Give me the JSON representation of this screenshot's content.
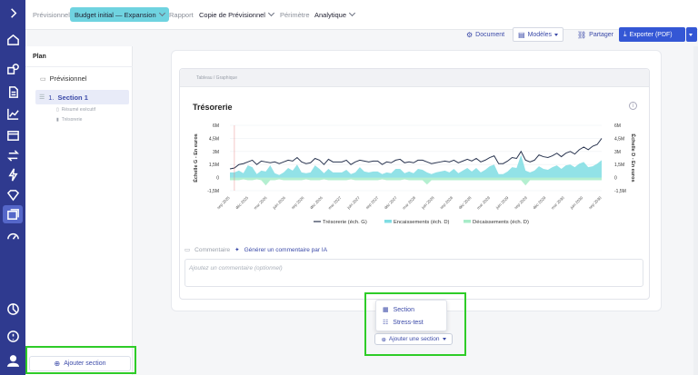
{
  "topbar": {
    "previsionnel_label": "Prévisionnel",
    "budget_value": "Budget initial — Expansion",
    "rapport_label": "Rapport",
    "rapport_value": "Copie de Prévisionnel",
    "perimetre_label": "Périmètre",
    "perimetre_value": "Analytique"
  },
  "toolbar": {
    "document": "Document",
    "modeles": "Modèles",
    "partager": "Partager",
    "exporter": "Exporter (PDF)"
  },
  "plan": {
    "title": "Plan",
    "previsionnel": "Prévisionnel",
    "section_number": "1.",
    "section_label": "Section 1",
    "sub_items": [
      "Résumé exécutif",
      "Trésorerie"
    ],
    "add_section": "Ajouter section"
  },
  "card": {
    "header_label": "Tableau / Graphique",
    "title": "Trésorerie",
    "comment_label": "Commentaire",
    "ia_button": "Générer un commentaire par IA",
    "comment_placeholder": "Ajoutez un commentaire (optionnel)"
  },
  "menu": {
    "items": [
      "Section",
      "Stress-test"
    ],
    "add_button": "Ajouter une section"
  },
  "colors": {
    "rail": "#2f3a8f",
    "accent": "#3457d5",
    "line": "#2a3550",
    "encaissements": "#7fdde3",
    "decaissements": "#a7ecc8",
    "highlight": "#2ecc28"
  },
  "chart_data": {
    "type": "line",
    "ylabel_left": "Échelle G - En euros",
    "ylabel_right": "Échelle D - En euros",
    "yticks_left": [
      "6M",
      "4,5M",
      "3M",
      "1,5M",
      "0",
      "-1,5M"
    ],
    "yticks_right": [
      "6M",
      "4,5M",
      "3M",
      "1,5M",
      "0",
      "-1,5M"
    ],
    "ylim": [
      -1.5,
      6
    ],
    "x_labels": [
      "sep 2025",
      "déc 2025",
      "mar 2026",
      "juin 2026",
      "sep 2026",
      "déc 2026",
      "mar 2027",
      "juin 2027",
      "sep 2027",
      "déc 2027",
      "mar 2028",
      "juin 2028",
      "sep 2028",
      "déc 2028",
      "mar 2029",
      "juin 2029",
      "sep 2029",
      "déc 2029",
      "mar 2030",
      "juin 2030",
      "sep 2030"
    ],
    "series": [
      {
        "name": "Trésorerie (éch. G)",
        "kind": "line",
        "values": [
          1.0,
          1.1,
          1.5,
          1.6,
          1.8,
          2.0,
          1.5,
          1.9,
          1.8,
          1.7,
          1.8,
          1.6,
          1.8,
          2.0,
          1.9,
          2.3,
          1.8,
          1.6,
          1.7,
          2.2,
          2.0,
          1.5,
          2.1,
          1.8,
          1.8,
          1.8,
          2.0,
          1.5,
          1.8,
          2.0,
          1.9,
          1.8,
          1.9,
          1.9,
          1.5,
          1.8,
          1.7,
          2.0,
          2.1,
          1.7,
          1.8,
          1.7,
          2.0,
          2.0,
          1.8,
          1.6,
          1.7,
          1.8,
          1.9,
          1.8,
          2.0,
          1.7,
          1.9,
          2.1,
          1.9,
          2.2,
          1.8,
          2.0,
          2.3,
          2.5,
          1.6,
          1.6,
          1.9,
          2.3,
          2.2,
          3.0,
          2.0,
          1.8,
          2.0,
          2.6,
          2.4,
          2.3,
          2.5,
          2.8,
          2.4,
          2.8,
          3.0,
          2.7,
          3.2,
          3.5,
          3.2,
          3.6,
          3.8,
          4.5
        ]
      },
      {
        "name": "Encaissements (éch. D)",
        "kind": "area",
        "values": [
          0.6,
          0.6,
          0.8,
          0.5,
          1.4,
          1.2,
          0.4,
          0.8,
          0.7,
          1.4,
          0.5,
          0.3,
          0.6,
          1.1,
          0.8,
          1.5,
          0.6,
          0.5,
          0.6,
          1.4,
          1.0,
          0.5,
          1.0,
          0.6,
          0.6,
          0.6,
          0.9,
          0.4,
          0.6,
          1.2,
          0.7,
          0.6,
          0.7,
          0.7,
          0.4,
          0.6,
          0.5,
          1.0,
          1.0,
          0.5,
          0.7,
          0.5,
          1.0,
          0.9,
          0.6,
          0.4,
          0.6,
          0.7,
          0.8,
          0.6,
          1.0,
          0.5,
          0.8,
          1.1,
          0.7,
          1.1,
          0.6,
          0.9,
          1.3,
          1.5,
          0.4,
          0.4,
          0.7,
          1.2,
          1.1,
          2.6,
          0.8,
          0.6,
          0.8,
          1.3,
          1.0,
          0.9,
          1.2,
          1.4,
          1.0,
          1.4,
          1.5,
          1.2,
          1.6,
          1.8,
          1.2,
          1.3,
          1.6,
          2.0
        ]
      },
      {
        "name": "Décaissements (éch. D)",
        "kind": "area",
        "values": [
          -0.3,
          -0.3,
          -0.3,
          -0.2,
          -0.3,
          -0.3,
          -0.2,
          -0.3,
          -0.9,
          -0.3,
          -0.3,
          -0.2,
          -0.3,
          -0.3,
          -0.3,
          -0.3,
          -0.3,
          -0.2,
          -0.3,
          -0.3,
          -0.3,
          -0.2,
          -0.3,
          -0.3,
          -0.3,
          -0.3,
          -0.3,
          -0.2,
          -0.3,
          -0.3,
          -0.3,
          -0.3,
          -0.3,
          -0.3,
          -0.2,
          -0.3,
          -0.3,
          -0.3,
          -0.3,
          -0.2,
          -0.3,
          -0.3,
          -0.3,
          -0.3,
          -0.8,
          -0.3,
          -0.3,
          -0.3,
          -0.3,
          -0.3,
          -0.3,
          -0.3,
          -0.3,
          -0.3,
          -0.3,
          -0.3,
          -0.3,
          -0.3,
          -0.3,
          -0.3,
          -0.3,
          -0.3,
          -0.3,
          -0.3,
          -0.3,
          -0.3,
          -0.9,
          -0.3,
          -0.3,
          -0.3,
          -0.3,
          -0.3,
          -0.3,
          -0.3,
          -0.3,
          -0.3,
          -0.3,
          -0.3,
          -0.3,
          -0.3,
          -0.3,
          -0.3,
          -0.3,
          -0.3
        ]
      }
    ],
    "legend_position": "bottom"
  }
}
